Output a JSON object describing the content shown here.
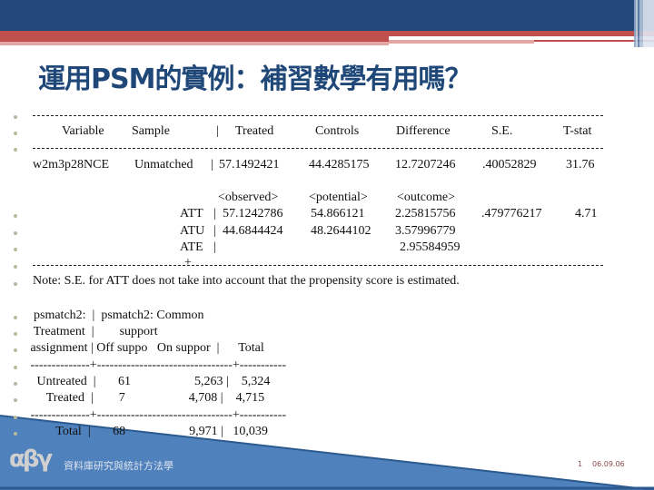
{
  "slide": {
    "title": "運用PSM的實例：補習數學有用嗎？",
    "theme_colors": {
      "header_blue": "#23497a",
      "header_red": "#c0504d",
      "title_color": "#1f4778",
      "footer_blue": "#4f81bd"
    }
  },
  "ttest_table": {
    "rule": "-----------------------------------------------------------------------------------------------------------------------",
    "header": {
      "variable": "Variable",
      "sample": "Sample",
      "sep": "|",
      "treated": "Treated",
      "controls": "Controls",
      "difference": "Difference",
      "se": "S.E.",
      "tstat": "T-stat"
    },
    "unmatched_row": {
      "variable": "w2m3p28NCE",
      "sample": "Unmatched",
      "sep": "|",
      "treated": "57.1492421",
      "controls": "44.4285175",
      "difference": "12.7207246",
      "se": ".40052829",
      "tstat": "31.76"
    },
    "effects_header": {
      "observed": "<observed>",
      "potential": "<potential>",
      "outcome": "<outcome>"
    },
    "effects": [
      {
        "label": "ATT",
        "sep": "|",
        "observed": "57.1242786",
        "potential": "54.866121",
        "outcome": "2.25815756",
        "se": ".479776217",
        "tstat": "4.71"
      },
      {
        "label": "ATU",
        "sep": "|",
        "observed": "44.6844424",
        "potential": "48.2644102",
        "outcome": "3.57996779",
        "se": "",
        "tstat": ""
      },
      {
        "label": "ATE",
        "sep": "|",
        "observed": "",
        "potential": "",
        "outcome": "2.95584959",
        "se": "",
        "tstat": ""
      }
    ],
    "bottom_rule": "---------------------------+-----------------------------------------------------------------------------------------",
    "note": "Note: S.E. for ATT does not take into account that the propensity score is estimated."
  },
  "support_table": {
    "lines": [
      "  psmatch2:  |  psmatch2: Common",
      "  Treatment  |        support",
      " assignment | Off suppo   On suppor  |      Total",
      " --------------+--------------------------------+-----------",
      "   Untreated  |       61                    5,263 |    5,324",
      "      Treated  |        7                    4,708 |    4,715",
      " --------------+--------------------------------+-----------",
      "         Total  |       68                    9,971 |   10,039"
    ],
    "rows": [
      {
        "label": "Untreated",
        "off_support": "61",
        "on_support": "5,263",
        "total": "5,324"
      },
      {
        "label": "Treated",
        "off_support": "7",
        "on_support": "4,708",
        "total": "4,715"
      },
      {
        "label": "Total",
        "off_support": "68",
        "on_support": "9,971",
        "total": "10,039"
      }
    ]
  },
  "footer": {
    "logo": "αβγ",
    "org": "資料庫研究與統計方法學",
    "page_number": "1",
    "date": "06.09.06"
  }
}
